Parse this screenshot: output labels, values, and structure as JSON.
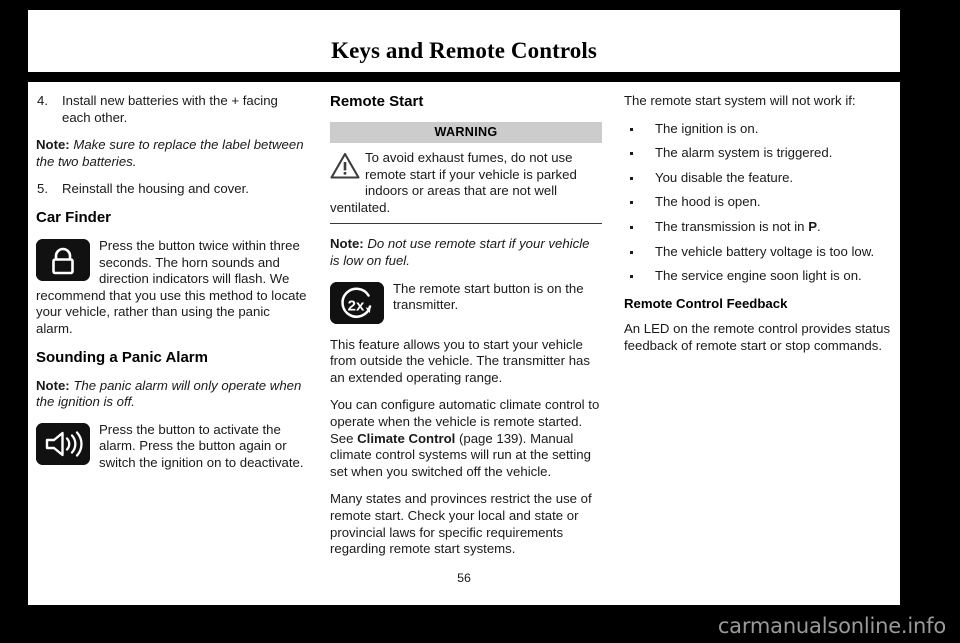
{
  "header": {
    "title": "Keys and Remote Controls"
  },
  "columns": {
    "left": {
      "step4": {
        "num": "4.",
        "text": "Install new batteries with the + facing each other."
      },
      "note1_label": "Note:",
      "note1_text": " Make sure to replace the label between the two batteries.",
      "step5": {
        "num": "5.",
        "text": "Reinstall the housing and cover."
      },
      "heading_car_finder": "Car Finder",
      "car_finder_icon": "lock-icon",
      "car_finder_text": "Press the button twice within three seconds. The horn sounds and direction indicators will flash. We recommend that you use this method to locate your vehicle, rather than using the panic alarm.",
      "heading_panic_alarm": "Sounding a Panic Alarm",
      "note2_label": "Note:",
      "note2_text": " The panic alarm will only operate when the ignition is off.",
      "panic_icon": "horn-speaker-icon",
      "panic_text": "Press the button to activate the alarm. Press the button again or switch the ignition on to deactivate."
    },
    "middle": {
      "heading_remote_start": "Remote Start",
      "warning_title": "WARNING",
      "warning_icon": "warning-triangle-icon",
      "warning_text": "To avoid exhaust fumes, do not use remote start if your vehicle is parked indoors or areas that are not well ventilated.",
      "note_label": "Note:",
      "note_text": " Do not use remote start if your vehicle is low on fuel.",
      "remote_start_icon": "remote-start-2x-icon",
      "remote_start_icon_text": "The remote start button is on the transmitter.",
      "para_feature": "This feature allows you to start your vehicle from outside the vehicle. The transmitter has an extended operating range.",
      "para_climate_1": "You can configure automatic climate control to operate when the vehicle is remote started.  See ",
      "para_climate_link": "Climate Control",
      "para_climate_2": " (page 139). Manual climate control systems will run at the setting set when you switched off the vehicle.",
      "para_states": "Many states and provinces restrict the use of remote start. Check your local and state or provincial laws for specific requirements regarding remote start systems."
    },
    "right": {
      "intro": "The remote start system will not work if:",
      "bullets": [
        {
          "text": "The ignition is on.",
          "emphasis": ""
        },
        {
          "text": "The alarm system is triggered.",
          "emphasis": ""
        },
        {
          "text": "You disable the feature.",
          "emphasis": ""
        },
        {
          "text": "The hood is open.",
          "emphasis": ""
        },
        {
          "text": "The transmission is not in ",
          "emphasis": "P",
          "suffix": "."
        },
        {
          "text": "The vehicle battery voltage is too low.",
          "emphasis": ""
        },
        {
          "text": "The service engine soon light is on.",
          "emphasis": ""
        }
      ],
      "heading_feedback": "Remote Control Feedback",
      "feedback_text": "An LED on the remote control provides status feedback of remote start or stop commands."
    }
  },
  "folio": "56",
  "watermark": "carmanualsonline.info",
  "colors": {
    "page_background": "#ffffff",
    "screen_background": "#000000",
    "text": "#1a1a1a",
    "warning_bar": "#cccccc",
    "icon_badge": "#111111",
    "watermark": "#9a9a9a"
  }
}
